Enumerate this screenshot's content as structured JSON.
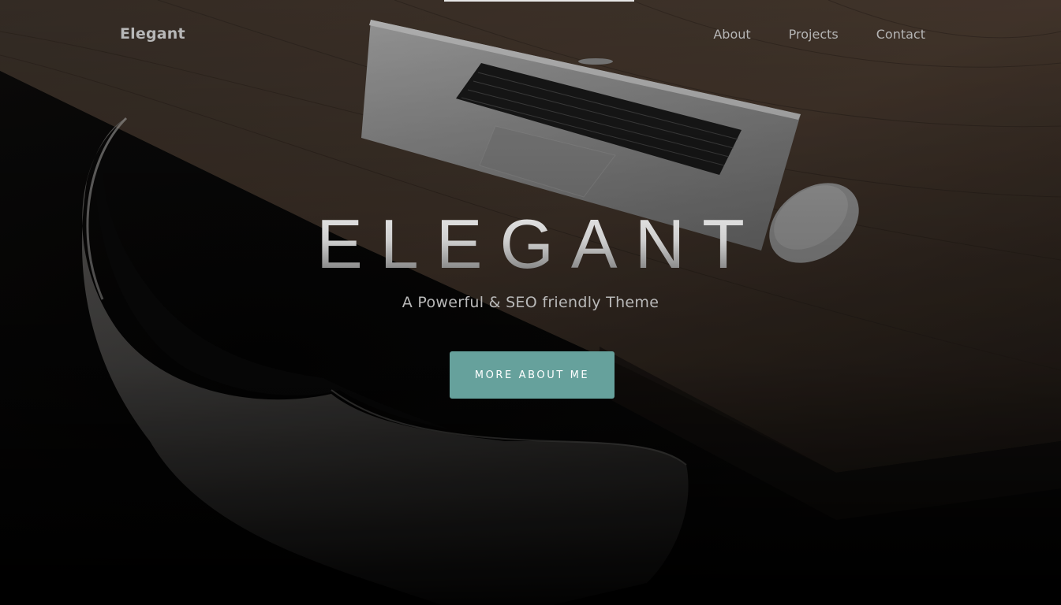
{
  "nav": {
    "brand": "Elegant",
    "links": [
      "About",
      "Projects",
      "Contact"
    ]
  },
  "hero": {
    "title": "ELEGANT",
    "subtitle": "A Powerful & SEO friendly Theme",
    "cta_label": "MORE ABOUT ME"
  },
  "colors": {
    "accent": "#66a19c",
    "nav_text": "#b5b5b5"
  }
}
